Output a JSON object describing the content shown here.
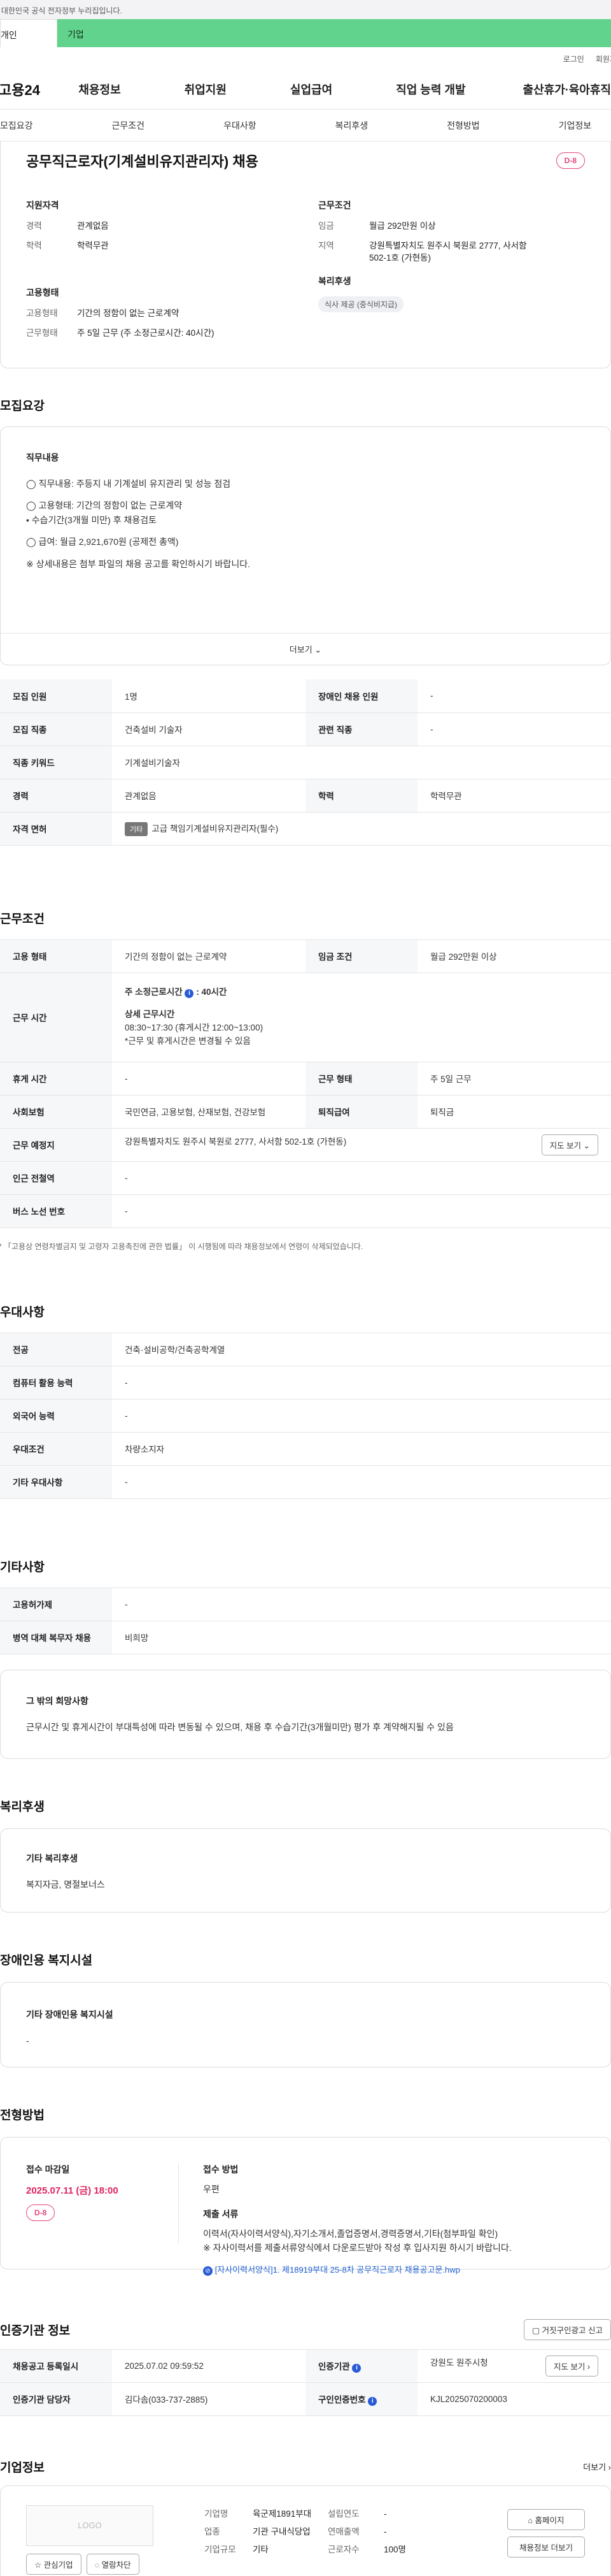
{
  "gov_notice": "이 누리집은 대한민국 공식 전자정부 누리집입니다.",
  "tabs": [
    "개인",
    "기업"
  ],
  "util": [
    "로그인",
    "회원가입"
  ],
  "logo": "고용24",
  "gnb": [
    "채용정보",
    "취업지원",
    "실업급여",
    "직업 능력 개발",
    "출산휴가·육아휴직"
  ],
  "snb": [
    "모집요강",
    "근무조건",
    "우대사항",
    "복리후생",
    "전형방법",
    "기업정보"
  ],
  "job": {
    "title": "공무직근로자(기계설비유지관리자) 채용",
    "dday": "D-8",
    "qual_title": "지원자격",
    "qual": [
      {
        "k": "경력",
        "v": "관계없음"
      },
      {
        "k": "학력",
        "v": "학력무관"
      }
    ],
    "cond_title": "근무조건",
    "cond": [
      {
        "k": "임금",
        "v": "월급 292만원 이상"
      },
      {
        "k": "지역",
        "v": "강원특별자치도 원주시 북원로 2777, 사서함 502-1호 (가현동)"
      }
    ],
    "emp_title": "고용형태",
    "emp": [
      {
        "k": "고용형태",
        "v": "기간의 정함이 없는 근로계약"
      },
      {
        "k": "근무형태",
        "v": "주 5일 근무 (주 소정근로시간: 40시간)"
      }
    ],
    "welfare_title": "복리후생",
    "welfare_chip": "식사 제공 (중식비지급)"
  },
  "recruit": {
    "title": "모집요강",
    "duty_title": "직무내용",
    "duty_lines": [
      "◯ 직무내용: 주등지 내 기계설비 유지관리 및 성능 점검",
      "◯ 고용형태: 기간의 정함이 없는 근로계약",
      "• 수습기간(3개월 미만) 후 채용검토",
      "◯ 급여: 월급 2,921,670원 (공제전 총액)",
      "※ 상세내용은 첨부 파일의 채용 공고를 확인하시기 바랍니다."
    ],
    "more": "더보기 ⌄",
    "rows": [
      [
        "모집 인원",
        "1명",
        "장애인 채용 인원",
        "-"
      ],
      [
        "모집 직종",
        "건축설비 기술자",
        "관련 직종",
        "-"
      ],
      [
        "직종 키워드",
        "기계설비기술자",
        "",
        ""
      ],
      [
        "경력",
        "관계없음",
        "학력",
        "학력무관"
      ],
      [
        "자격 면허",
        "",
        "",
        ""
      ]
    ],
    "license_tag": "기타",
    "license": "고급 책임기계설비유지관리자(필수)"
  },
  "work": {
    "title": "근무조건",
    "emp_h": "고용 형태",
    "emp_v": "기간의 정함이 없는 근로계약",
    "wage_h": "임금 조건",
    "wage_v": "월급 292만원 이상",
    "time_h": "근무 시간",
    "time_l1": "주 소정근로시간",
    "time_l1b": "40시간",
    "time_l2": "상세 근무시간",
    "time_l3": "08:30~17:30 (휴게시간 12:00~13:00)",
    "time_l4": "*근무 및 휴게시간은 변경될 수 있음",
    "rest_h": "휴게 시간",
    "rest_v": "-",
    "form_h": "근무 형태",
    "form_v": "주 5일 근무",
    "ins_h": "사회보험",
    "ins_v": "국민연금, 고용보험, 산재보험, 건강보험",
    "ret_h": "퇴직급여",
    "ret_v": "퇴직금",
    "place_h": "근무 예정지",
    "place_v": "강원특별자치도 원주시 북원로 2777, 사서함 502-1호 (가현동)",
    "map_btn": "지도 보기 ⌄",
    "sub_h": "인근 전철역",
    "sub_v": "-",
    "bus_h": "버스 노선 번호",
    "bus_v": "-",
    "note": "* 「고용상 연령차별금지 및 고령자 고용촉진에 관한 법률」 이 시행됨에 따라 채용정보에서 연령이 삭제되었습니다."
  },
  "pref": {
    "title": "우대사항",
    "rows": [
      [
        "전공",
        "건축·설비공학/건축공학계열"
      ],
      [
        "컴퓨터 활용 능력",
        "-"
      ],
      [
        "외국어 능력",
        "-"
      ],
      [
        "우대조건",
        "차량소지자"
      ],
      [
        "기타 우대사항",
        "-"
      ]
    ]
  },
  "etc": {
    "title": "기타사항",
    "rows": [
      [
        "고용허가제",
        "-"
      ],
      [
        "병역 대체 복무자 채용",
        "비희망"
      ]
    ],
    "box_title": "그 밖의 희망사항",
    "box_text": "근무시간 및 휴게시간이 부대특성에 따라 변동될 수 있으며, 채용 후 수습기간(3개월미만) 평가 후 계약해지될 수 있음"
  },
  "benefit": {
    "title": "복리후생",
    "box_title": "기타 복리후생",
    "box_text": "복지자금, 명절보너스"
  },
  "disab": {
    "title": "장애인용 복지시설",
    "box_title": "기타 장애인용 복지시설",
    "box_text": "-"
  },
  "select": {
    "title": "전형방법",
    "deadline_t": "접수 마감일",
    "deadline": "2025.07.11 (금) 18:00",
    "dday": "D-8",
    "method_t": "접수 방법",
    "method": "우편",
    "docs_t": "제출 서류",
    "docs1": "이력서(자사이력서양식),자기소개서,졸업증명서,경력증명서,기타(첨부파일 확인)",
    "docs2": "※ 자사이력서를 제출서류양식에서 다운로드받아 작성 후 입사지원 하시기 바랍니다.",
    "file": "[자사이력서양식]1. 제18919부대 25-8차 공무직근로자 채용공고문.hwp"
  },
  "cert": {
    "title": "인증기관 정보",
    "report_btn": "거짓구인광고 신고",
    "r1": [
      "채용공고 등록일시",
      "2025.07.02 09:59:52",
      "인증기관",
      "강원도 원주시청"
    ],
    "map_btn": "지도 보기 ›",
    "r2": [
      "인증기관 담당자",
      "김다솜(033-737-2885)",
      "구인인증번호",
      "KJL2025070200003"
    ]
  },
  "company": {
    "title": "기업정보",
    "more": "더보기 ›",
    "logo": "LOGO",
    "follow": "☆ 관심기업",
    "block": "◌ 열람차단",
    "f": [
      [
        "기업명",
        "육군제1891부대",
        "설립연도",
        "-"
      ],
      [
        "업종",
        "기관 구내식당업",
        "연매출액",
        "-"
      ],
      [
        "기업규모",
        "기타",
        "근로자수",
        "100명"
      ]
    ],
    "home_btn": "홈페이지",
    "jobs_btn": "채용정보 더보기"
  }
}
